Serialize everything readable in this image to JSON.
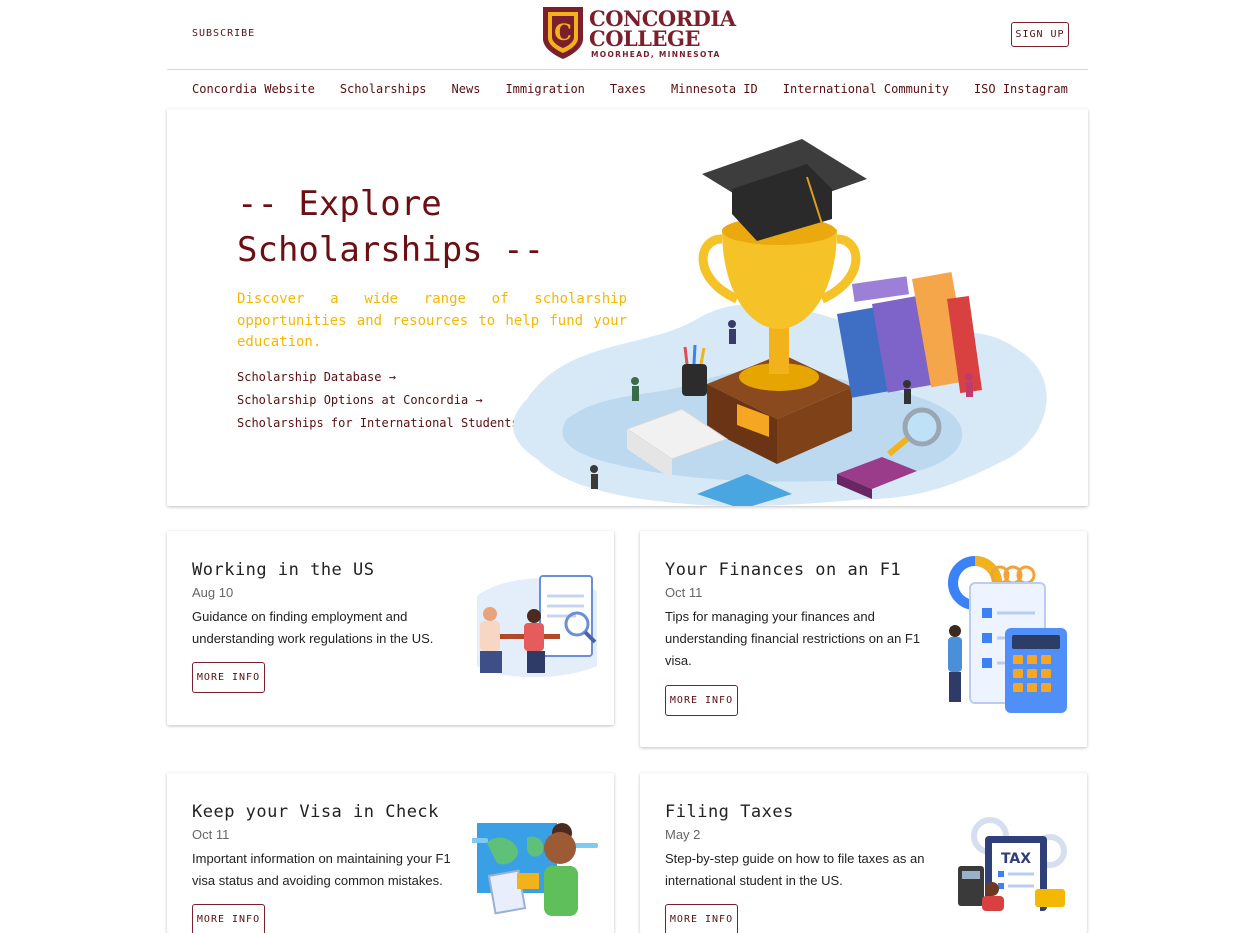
{
  "header": {
    "subscribe_label": "SUBSCRIBE",
    "signup_label": "SIGN UP",
    "logo": {
      "letter": "C",
      "line1": "CONCORDIA",
      "line2": "COLLEGE",
      "subline": "MOORHEAD, MINNESOTA"
    }
  },
  "nav": {
    "items": [
      {
        "label": "Concordia Website"
      },
      {
        "label": "Scholarships"
      },
      {
        "label": "News"
      },
      {
        "label": "Immigration"
      },
      {
        "label": "Taxes"
      },
      {
        "label": "Minnesota ID"
      },
      {
        "label": "International Community"
      },
      {
        "label": "ISO Instagram"
      }
    ]
  },
  "hero": {
    "title": "-- Explore Scholarships --",
    "description": "Discover a wide range of scholarship opportunities and resources to help fund your education.",
    "links": [
      {
        "label": "Scholarship Database →"
      },
      {
        "label": "Scholarship Options at Concordia →"
      },
      {
        "label": "Scholarships for International Students →"
      }
    ]
  },
  "cards": [
    {
      "title": "Working in the US",
      "date": "Aug 10",
      "description": "Guidance on finding employment and understanding work regulations in the US.",
      "button": "MORE INFO"
    },
    {
      "title": "Your Finances on an F1",
      "date": "Oct 11",
      "description": "Tips for managing your finances and understanding financial restrictions on an F1 visa.",
      "button": "MORE INFO"
    },
    {
      "title": "Keep your Visa in Check",
      "date": "Oct 11",
      "description": "Important information on maintaining your F1 visa status and avoiding common mistakes.",
      "button": "MORE INFO"
    },
    {
      "title": "Filing Taxes",
      "date": "May 2",
      "description": "Step-by-step guide on how to file taxes as an international student in the US.",
      "button": "MORE INFO"
    }
  ],
  "illustrations": {
    "tax_label": "TAX"
  },
  "colors": {
    "maroon": "#6b0f12",
    "gold": "#f5b800",
    "accent_blue": "#3b82f6"
  }
}
